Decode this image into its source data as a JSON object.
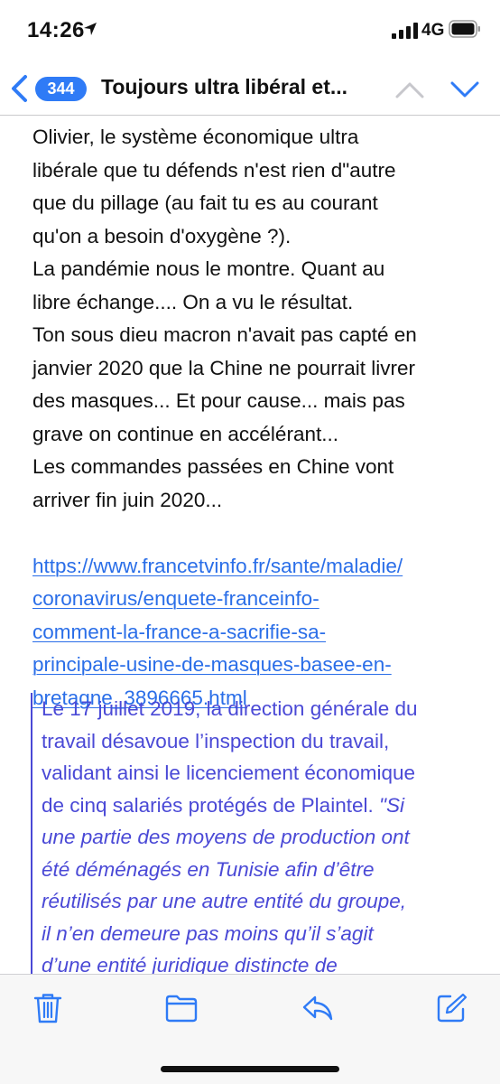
{
  "status_bar": {
    "time": "14:26",
    "network": "4G",
    "icons": [
      "location-arrow-icon",
      "cellular-signal-icon",
      "battery-icon"
    ]
  },
  "nav": {
    "back_count": "344",
    "title": "Toujours ultra libéral et...",
    "icons": [
      "back-chevron-icon",
      "previous-message-chevron-icon",
      "next-message-chevron-icon"
    ]
  },
  "message": {
    "body_lines": [
      "Olivier, le système économique ultra",
      "libérale que tu défends n'est rien d\"autre",
      "que du pillage (au fait tu es au courant",
      "qu'on a besoin d'oxygène ?).",
      "La pandémie nous le montre. Quant au",
      "libre échange.... On a vu le résultat.",
      "Ton sous dieu macron n'avait pas capté en",
      "janvier 2020 que la Chine ne pourrait livrer",
      "des masques... Et pour cause... mais pas",
      "grave on continue en accélérant...",
      "Les commandes passées en Chine vont",
      "arriver fin juin 2020..."
    ],
    "link_lines": [
      "https://www.francetvinfo.fr/sante/maladie/",
      "coronavirus/enquete-franceinfo-",
      "comment-la-france-a-sacrifie-sa-",
      "principale-usine-de-masques-basee-en-",
      "bretagne_3896665.html"
    ],
    "quote_lines": [
      {
        "text": "Le 17 juillet 2019, la direction générale du",
        "italic": false
      },
      {
        "text": "travail désavoue l’inspection du travail,",
        "italic": false
      },
      {
        "text": "validant ainsi le licenciement économique",
        "italic": false
      },
      {
        "text": "de cinq salariés protégés de Plaintel. ",
        "italic": false,
        "tail": "\"Si"
      },
      {
        "text": "une partie des moyens de production ont",
        "italic": true
      },
      {
        "text": "été déménagés en Tunisie afin d’être",
        "italic": true
      },
      {
        "text": "réutilisés par une autre entité du groupe,",
        "italic": true
      },
      {
        "text": "il n’en demeure pas moins qu’il s’agit",
        "italic": true
      },
      {
        "text": "d’une entité juridique distincte de",
        "italic": true
      }
    ]
  },
  "toolbar": {
    "icons": [
      "trash-icon",
      "folder-icon",
      "reply-icon",
      "compose-icon"
    ]
  },
  "colors": {
    "accent": "#2f7bf6",
    "link": "#2a6ee8",
    "quote": "#4a49d6",
    "disabled": "#c7c7cc"
  }
}
